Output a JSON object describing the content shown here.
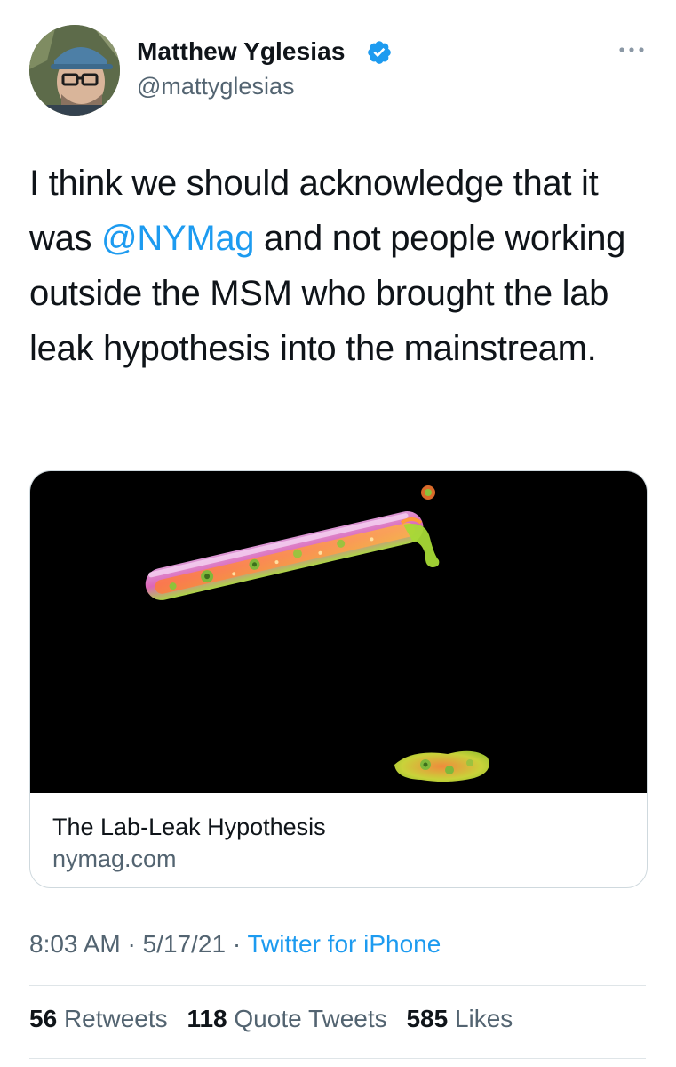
{
  "author": {
    "name": "Matthew Yglesias",
    "handle": "@mattyglesias",
    "verified": true
  },
  "tweet": {
    "text_before": "I think we should acknowledge that it was ",
    "mention": "@NYMag",
    "text_after": " and not people working outside the MSM who brought the lab leak hypothesis into the mainstream."
  },
  "link_card": {
    "title": "The Lab-Leak Hypothesis",
    "domain": "nymag.com"
  },
  "meta": {
    "time": "8:03 AM",
    "date": "5/17/21",
    "separator": "·",
    "source": "Twitter for iPhone"
  },
  "stats": {
    "retweets_count": "56",
    "retweets_label": "Retweets",
    "quote_count": "118",
    "quote_label": "Quote Tweets",
    "likes_count": "585",
    "likes_label": "Likes"
  },
  "colors": {
    "accent": "#1d9bf0",
    "secondary_text": "#536471",
    "primary_text": "#0f1419"
  },
  "icons": {
    "verified": "verified-badge-icon",
    "more": "more-options-icon"
  }
}
